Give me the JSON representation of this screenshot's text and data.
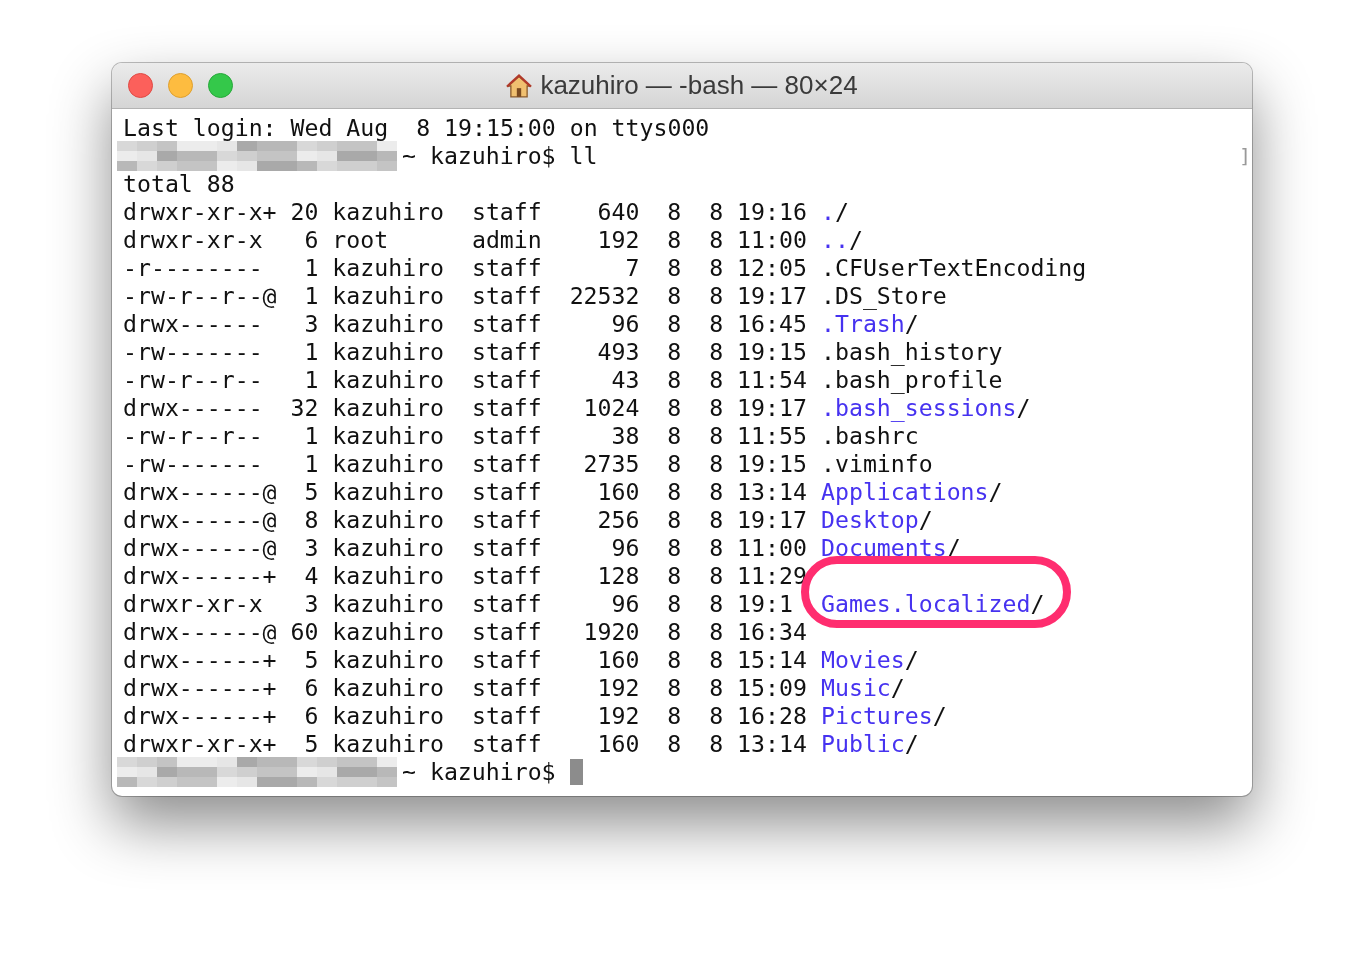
{
  "window": {
    "title": "kazuhiro — -bash — 80×24"
  },
  "login_line": "Last login: Wed Aug  8 19:15:00 on ttys000",
  "command_line": {
    "prompt": "~ kazuhiro$",
    "command": "ll"
  },
  "mark": "]",
  "total_line": "total 88",
  "rows": [
    {
      "perms": "drwxr-xr-x+",
      "links": "20",
      "owner": "kazuhiro",
      "group": "staff",
      "size": "640",
      "month": "8",
      "day": "8",
      "time": "19:16",
      "name": ".",
      "suffix": "/",
      "kind": "dir",
      "highlighted": false
    },
    {
      "perms": "drwxr-xr-x",
      "links": "6",
      "owner": "root",
      "group": "admin",
      "size": "192",
      "month": "8",
      "day": "8",
      "time": "11:00",
      "name": "..",
      "suffix": "/",
      "kind": "dir",
      "highlighted": false
    },
    {
      "perms": "-r--------",
      "links": "1",
      "owner": "kazuhiro",
      "group": "staff",
      "size": "7",
      "month": "8",
      "day": "8",
      "time": "12:05",
      "name": ".CFUserTextEncoding",
      "kind": "file",
      "highlighted": false
    },
    {
      "perms": "-rw-r--r--@",
      "links": "1",
      "owner": "kazuhiro",
      "group": "staff",
      "size": "22532",
      "month": "8",
      "day": "8",
      "time": "19:17",
      "name": ".DS_Store",
      "kind": "file",
      "highlighted": false
    },
    {
      "perms": "drwx------",
      "links": "3",
      "owner": "kazuhiro",
      "group": "staff",
      "size": "96",
      "month": "8",
      "day": "8",
      "time": "16:45",
      "name": ".Trash",
      "suffix": "/",
      "kind": "dir",
      "highlighted": false
    },
    {
      "perms": "-rw-------",
      "links": "1",
      "owner": "kazuhiro",
      "group": "staff",
      "size": "493",
      "month": "8",
      "day": "8",
      "time": "19:15",
      "name": ".bash_history",
      "kind": "file",
      "highlighted": false
    },
    {
      "perms": "-rw-r--r--",
      "links": "1",
      "owner": "kazuhiro",
      "group": "staff",
      "size": "43",
      "month": "8",
      "day": "8",
      "time": "11:54",
      "name": ".bash_profile",
      "kind": "file",
      "highlighted": false
    },
    {
      "perms": "drwx------",
      "links": "32",
      "owner": "kazuhiro",
      "group": "staff",
      "size": "1024",
      "month": "8",
      "day": "8",
      "time": "19:17",
      "name": ".bash_sessions",
      "suffix": "/",
      "kind": "dir",
      "highlighted": false
    },
    {
      "perms": "-rw-r--r--",
      "links": "1",
      "owner": "kazuhiro",
      "group": "staff",
      "size": "38",
      "month": "8",
      "day": "8",
      "time": "11:55",
      "name": ".bashrc",
      "kind": "file",
      "highlighted": false
    },
    {
      "perms": "-rw-------",
      "links": "1",
      "owner": "kazuhiro",
      "group": "staff",
      "size": "2735",
      "month": "8",
      "day": "8",
      "time": "19:15",
      "name": ".viminfo",
      "kind": "file",
      "highlighted": false
    },
    {
      "perms": "drwx------@",
      "links": "5",
      "owner": "kazuhiro",
      "group": "staff",
      "size": "160",
      "month": "8",
      "day": "8",
      "time": "13:14",
      "name": "Applications",
      "suffix": "/",
      "kind": "dir",
      "highlighted": false
    },
    {
      "perms": "drwx------@",
      "links": "8",
      "owner": "kazuhiro",
      "group": "staff",
      "size": "256",
      "month": "8",
      "day": "8",
      "time": "19:17",
      "name": "Desktop",
      "suffix": "/",
      "kind": "dir",
      "highlighted": false
    },
    {
      "perms": "drwx------@",
      "links": "3",
      "owner": "kazuhiro",
      "group": "staff",
      "size": "96",
      "month": "8",
      "day": "8",
      "time": "11:00",
      "name": "Documents",
      "suffix": "/",
      "kind": "dir",
      "highlighted": false
    },
    {
      "perms": "drwx------+",
      "links": "4",
      "owner": "kazuhiro",
      "group": "staff",
      "size": "128",
      "month": "8",
      "day": "8",
      "time": "11:29",
      "highlighted": false
    },
    {
      "perms": "drwxr-xr-x",
      "links": "3",
      "owner": "kazuhiro",
      "group": "staff",
      "size": "96",
      "month": "8",
      "day": "8",
      "time": "19:1",
      "name": "Games.localized",
      "suffix": "/",
      "kind": "dir",
      "highlighted": true
    },
    {
      "perms": "drwx------@",
      "links": "60",
      "owner": "kazuhiro",
      "group": "staff",
      "size": "1920",
      "month": "8",
      "day": "8",
      "time": "16:34",
      "highlighted": false
    },
    {
      "perms": "drwx------+",
      "links": "5",
      "owner": "kazuhiro",
      "group": "staff",
      "size": "160",
      "month": "8",
      "day": "8",
      "time": "15:14",
      "name": "Movies",
      "suffix": "/",
      "kind": "dir",
      "highlighted": false
    },
    {
      "perms": "drwx------+",
      "links": "6",
      "owner": "kazuhiro",
      "group": "staff",
      "size": "192",
      "month": "8",
      "day": "8",
      "time": "15:09",
      "name": "Music",
      "suffix": "/",
      "kind": "dir",
      "highlighted": false
    },
    {
      "perms": "drwx------+",
      "links": "6",
      "owner": "kazuhiro",
      "group": "staff",
      "size": "192",
      "month": "8",
      "day": "8",
      "time": "16:28",
      "name": "Pictures",
      "suffix": "/",
      "kind": "dir",
      "highlighted": false
    },
    {
      "perms": "drwxr-xr-x+",
      "links": "5",
      "owner": "kazuhiro",
      "group": "staff",
      "size": "160",
      "month": "8",
      "day": "8",
      "time": "13:14",
      "name": "Public",
      "suffix": "/",
      "kind": "dir",
      "highlighted": false
    }
  ],
  "final_prompt": "~ kazuhiro$"
}
